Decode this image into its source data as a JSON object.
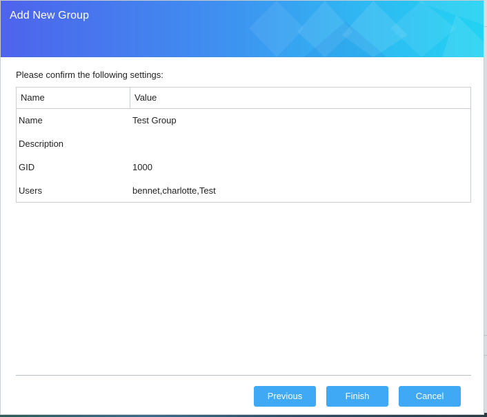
{
  "dialog": {
    "title": "Add New Group",
    "prompt": "Please confirm the following settings:"
  },
  "table": {
    "headers": [
      "Name",
      "Value"
    ],
    "rows": [
      {
        "name": "Name",
        "value": "Test Group"
      },
      {
        "name": "Description",
        "value": ""
      },
      {
        "name": "GID",
        "value": "1000"
      },
      {
        "name": "Users",
        "value": "bennet,charlotte,Test"
      }
    ]
  },
  "buttons": {
    "previous": "Previous",
    "finish": "Finish",
    "cancel": "Cancel"
  },
  "colors": {
    "button": "#3fa9f5",
    "header_start": "#4e63ec",
    "header_end": "#22d3f2"
  }
}
